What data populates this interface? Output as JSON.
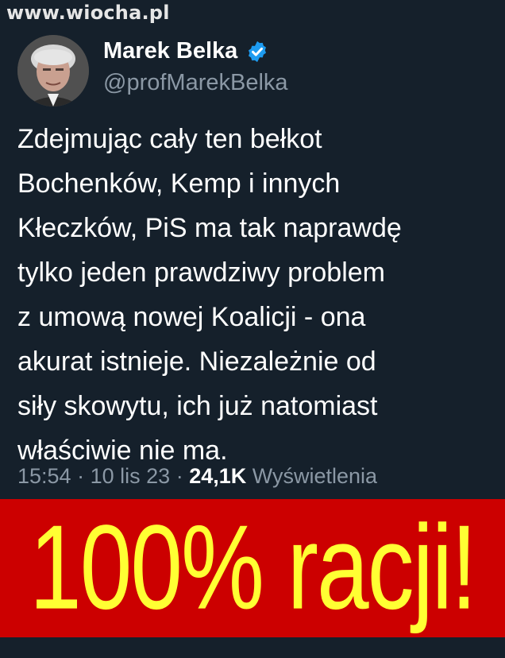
{
  "watermark": "www.wiocha.pl",
  "user": {
    "name": "Marek Belka",
    "handle": "@profMarekBelka"
  },
  "tweet": {
    "lines": [
      "Zdejmując cały ten bełkot",
      "Bochenków, Kemp i innych",
      "Kłeczków, PiS ma tak naprawdę",
      "tylko jeden prawdziwy problem",
      "z umową nowej Koalicji - ona",
      "akurat istnieje. Niezależnie od",
      "siły skowytu, ich już natomiast",
      "właściwie nie ma."
    ],
    "time": "15:54",
    "date": "10 lis 23",
    "views_count": "24,1K",
    "views_label": "Wyświetlenia"
  },
  "banner": {
    "text": "100% racji!"
  },
  "colors": {
    "background": "#15202b",
    "verified": "#1d9bf0",
    "banner_bg": "#cc0000",
    "banner_text": "#ffff33"
  }
}
